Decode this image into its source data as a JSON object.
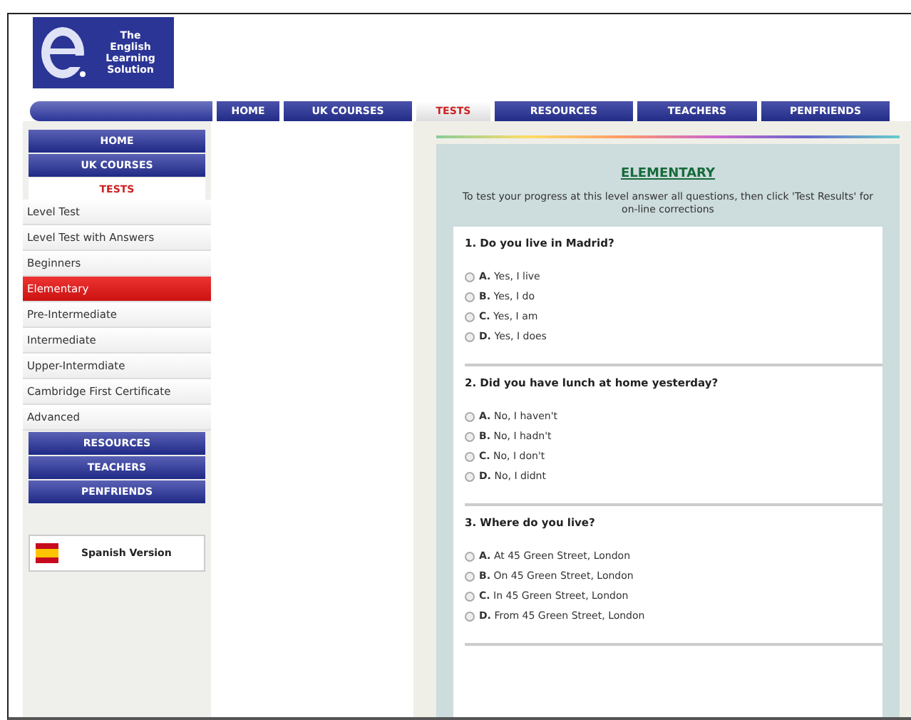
{
  "logo": {
    "lines": [
      "The",
      "English",
      "Learning",
      "Solution"
    ]
  },
  "nav": [
    {
      "label": "HOME",
      "selected": false
    },
    {
      "label": "UK COURSES",
      "selected": false
    },
    {
      "label": "TESTS",
      "selected": true
    },
    {
      "label": "RESOURCES",
      "selected": false
    },
    {
      "label": "TEACHERS",
      "selected": false
    },
    {
      "label": "PENFRIENDS",
      "selected": false
    }
  ],
  "sidebar": {
    "sections_top": [
      {
        "label": "HOME",
        "selected": false
      },
      {
        "label": "UK COURSES",
        "selected": false
      },
      {
        "label": "TESTS",
        "selected": true
      }
    ],
    "items": [
      {
        "label": "Level Test",
        "selected": false
      },
      {
        "label": "Level Test with Answers",
        "selected": false
      },
      {
        "label": "Beginners",
        "selected": false
      },
      {
        "label": "Elementary",
        "selected": true
      },
      {
        "label": "Pre-Intermediate",
        "selected": false
      },
      {
        "label": "Intermediate",
        "selected": false
      },
      {
        "label": "Upper-Intermdiate",
        "selected": false
      },
      {
        "label": "Cambridge First Certificate",
        "selected": false
      },
      {
        "label": "Advanced",
        "selected": false
      }
    ],
    "sections_bottom": [
      {
        "label": "RESOURCES",
        "selected": false
      },
      {
        "label": "TEACHERS",
        "selected": false
      },
      {
        "label": "PENFRIENDS",
        "selected": false
      }
    ],
    "language": "Spanish Version"
  },
  "test": {
    "title": "ELEMENTARY",
    "intro": "To test your progress at this level answer all questions, then click 'Test Results' for on-line corrections",
    "questions": [
      {
        "text": "1. Do you live in Madrid?",
        "options": [
          {
            "letter": "A.",
            "text": "Yes, I live",
            "selected": false
          },
          {
            "letter": "B.",
            "text": "Yes, I do",
            "selected": false
          },
          {
            "letter": "C.",
            "text": "Yes, I am",
            "selected": false
          },
          {
            "letter": "D.",
            "text": "Yes, I does",
            "selected": false
          }
        ]
      },
      {
        "text": "2. Did you have lunch at home yesterday?",
        "options": [
          {
            "letter": "A.",
            "text": "No, I haven't",
            "selected": false
          },
          {
            "letter": "B.",
            "text": "No, I hadn't",
            "selected": false
          },
          {
            "letter": "C.",
            "text": "No, I don't",
            "selected": false
          },
          {
            "letter": "D.",
            "text": "No, I didnt",
            "selected": false
          }
        ]
      },
      {
        "text": "3. Where do you live?",
        "options": [
          {
            "letter": "A.",
            "text": "At 45 Green Street, London",
            "selected": false
          },
          {
            "letter": "B.",
            "text": "On 45 Green Street, London",
            "selected": false
          },
          {
            "letter": "C.",
            "text": "In 45 Green Street, London",
            "selected": false
          },
          {
            "letter": "D.",
            "text": "From 45 Green Street, London",
            "selected": false
          }
        ]
      }
    ]
  }
}
